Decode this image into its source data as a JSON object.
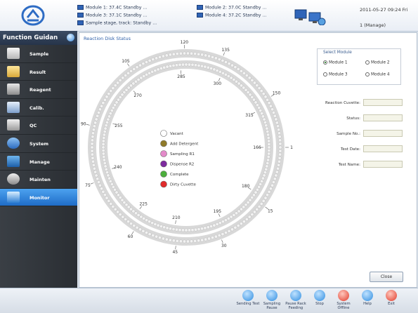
{
  "header": {
    "modules": [
      {
        "text": "Module 1: 37.4C Standby ..."
      },
      {
        "text": "Module 3: 37.1C Standby ..."
      },
      {
        "text": "Sample stage, track: Standby ..."
      },
      {
        "text": "Module 2: 37.0C Standby ..."
      },
      {
        "text": "Module 4: 37.2C Standby ..."
      }
    ],
    "datetime": "2011-05-27 09:24 Fri",
    "user": "1 (Manage)"
  },
  "sidebar": {
    "title": "Function Guidan",
    "items": [
      {
        "label": "Sample",
        "icon": "sample-icon"
      },
      {
        "label": "Result",
        "icon": "result-icon"
      },
      {
        "label": "Reagent",
        "icon": "reagent-icon"
      },
      {
        "label": "Calib.",
        "icon": "calibration-icon"
      },
      {
        "label": "QC",
        "icon": "qc-icon"
      },
      {
        "label": "System",
        "icon": "system-icon"
      },
      {
        "label": "Manage",
        "icon": "manage-icon"
      },
      {
        "label": "Mainten",
        "icon": "maintenance-icon"
      },
      {
        "label": "Monitor",
        "icon": "monitor-icon",
        "active": true
      }
    ]
  },
  "panel": {
    "title": "Reaction Disk Status",
    "outer_ticks": [
      "120",
      "135",
      "150",
      "1",
      "15",
      "30",
      "45",
      "60",
      "75",
      "90",
      "105"
    ],
    "inner_ticks": [
      "285",
      "300",
      "315",
      "166",
      "180",
      "195",
      "210",
      "225",
      "240",
      "255",
      "270"
    ],
    "legend": [
      {
        "label": "Vacant",
        "color": "#ffffff"
      },
      {
        "label": "Add Detergent",
        "color": "#8f7a2a"
      },
      {
        "label": "Sampling R1",
        "color": "#e38ac9"
      },
      {
        "label": "Dispense R2",
        "color": "#7d2a9e"
      },
      {
        "label": "Complete",
        "color": "#4cae3c"
      },
      {
        "label": "Dirty Cuvette",
        "color": "#e02a2a"
      }
    ],
    "select_module": {
      "title": "Select Module",
      "options": [
        {
          "label": "Module 1",
          "selected": true
        },
        {
          "label": "Module 2",
          "selected": false
        },
        {
          "label": "Module 3",
          "selected": false
        },
        {
          "label": "Module 4",
          "selected": false
        }
      ]
    },
    "fields": [
      {
        "label": "Reaction Cuvette:",
        "value": ""
      },
      {
        "label": "Status:",
        "value": ""
      },
      {
        "label": "Sample No.:",
        "value": ""
      },
      {
        "label": "Test Date:",
        "value": ""
      },
      {
        "label": "Test Name:",
        "value": ""
      }
    ],
    "close_label": "Close"
  },
  "toolbar": [
    {
      "label": "Sending Test",
      "icon": "sending-test-icon",
      "color": "#2f8de0"
    },
    {
      "label": "Sampling Pause",
      "icon": "sampling-pause-icon",
      "color": "#2f8de0"
    },
    {
      "label": "Pause Rack Feeding",
      "icon": "pause-rack-feeding-icon",
      "color": "#2f8de0"
    },
    {
      "label": "Stop",
      "icon": "stop-icon",
      "color": "#2f8de0"
    },
    {
      "label": "System Offline",
      "icon": "system-offline-icon",
      "color": "#e03a2a"
    },
    {
      "label": "Help",
      "icon": "help-icon",
      "color": "#2f8de0"
    },
    {
      "label": "Exit",
      "icon": "exit-icon",
      "color": "#e03a2a"
    }
  ]
}
